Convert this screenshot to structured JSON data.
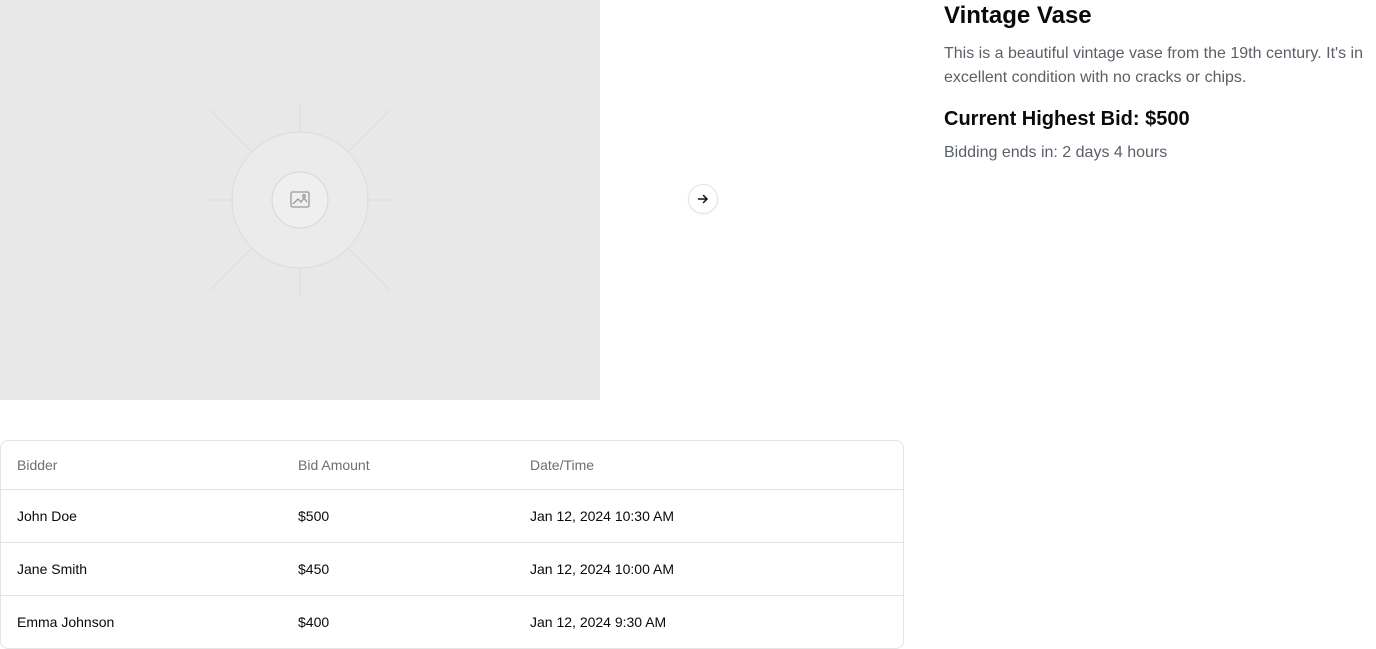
{
  "item": {
    "title": "Vintage Vase",
    "description": "This is a beautiful vintage vase from the 19th century. It's in excellent condition with no cracks or chips.",
    "highest_bid": "Current Highest Bid: $500",
    "ends_in": "Bidding ends in: 2 days 4 hours"
  },
  "image": {
    "placeholder_icon": "image-placeholder-icon"
  },
  "carousel": {
    "next_icon": "arrow-right-icon"
  },
  "bids_table": {
    "headers": [
      "Bidder",
      "Bid Amount",
      "Date/Time"
    ],
    "rows": [
      {
        "bidder": "John Doe",
        "amount": "$500",
        "datetime": "Jan 12, 2024 10:30 AM"
      },
      {
        "bidder": "Jane Smith",
        "amount": "$450",
        "datetime": "Jan 12, 2024 10:00 AM"
      },
      {
        "bidder": "Emma Johnson",
        "amount": "$400",
        "datetime": "Jan 12, 2024 9:30 AM"
      }
    ]
  },
  "colors": {
    "placeholder_bg": "#e8e8e8",
    "text_primary": "#0a0a0a",
    "text_muted": "#5b5f66",
    "border": "#e4e4e7"
  }
}
